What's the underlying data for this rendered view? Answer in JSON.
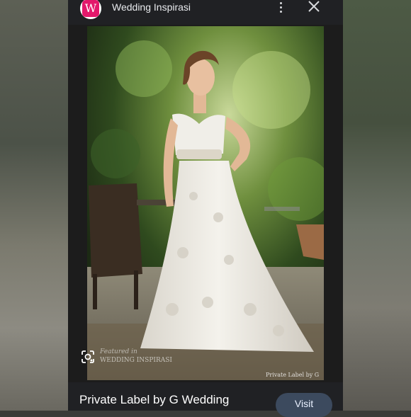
{
  "header": {
    "logo_letter": "W",
    "site_name": "Wedding Inspirasi"
  },
  "image": {
    "watermark_right": "Private Label by G",
    "watermark_left": "WEDDING INSPIRASI"
  },
  "footer": {
    "title": "Private Label by G Wedding",
    "visit_label": "Visit"
  },
  "colors": {
    "brand": "#e3186b",
    "visit_button": "#3c4a5e"
  }
}
